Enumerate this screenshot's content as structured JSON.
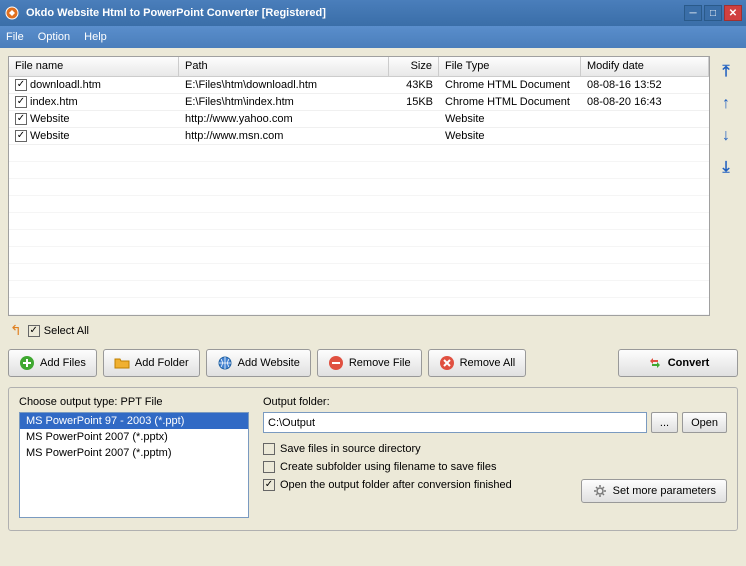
{
  "window": {
    "title": "Okdo Website Html to PowerPoint Converter [Registered]"
  },
  "menu": {
    "file": "File",
    "option": "Option",
    "help": "Help"
  },
  "table": {
    "headers": {
      "name": "File name",
      "path": "Path",
      "size": "Size",
      "type": "File Type",
      "date": "Modify date"
    },
    "rows": [
      {
        "checked": true,
        "name": "downloadl.htm",
        "path": "E:\\Files\\htm\\downloadl.htm",
        "size": "43KB",
        "type": "Chrome HTML Document",
        "date": "08-08-16 13:52"
      },
      {
        "checked": true,
        "name": "index.htm",
        "path": "E:\\Files\\htm\\index.htm",
        "size": "15KB",
        "type": "Chrome HTML Document",
        "date": "08-08-20 16:43"
      },
      {
        "checked": true,
        "name": "Website",
        "path": "http://www.yahoo.com",
        "size": "",
        "type": "Website",
        "date": ""
      },
      {
        "checked": true,
        "name": "Website",
        "path": "http://www.msn.com",
        "size": "",
        "type": "Website",
        "date": ""
      }
    ]
  },
  "selectall": {
    "label": "Select All",
    "checked": true
  },
  "buttons": {
    "add_files": "Add Files",
    "add_folder": "Add Folder",
    "add_website": "Add Website",
    "remove_file": "Remove File",
    "remove_all": "Remove All",
    "convert": "Convert"
  },
  "output_type": {
    "label": "Choose output type:",
    "current": "PPT File",
    "options": [
      "MS PowerPoint 97 - 2003 (*.ppt)",
      "MS PowerPoint 2007 (*.pptx)",
      "MS PowerPoint 2007 (*.pptm)"
    ],
    "selected_index": 0
  },
  "output": {
    "folder_label": "Output folder:",
    "folder_value": "C:\\Output",
    "browse": "...",
    "open": "Open",
    "save_source": "Save files in source directory",
    "save_source_checked": false,
    "subfolder": "Create subfolder using filename to save files",
    "subfolder_checked": false,
    "open_after": "Open the output folder after conversion finished",
    "open_after_checked": true,
    "more_params": "Set more parameters"
  }
}
